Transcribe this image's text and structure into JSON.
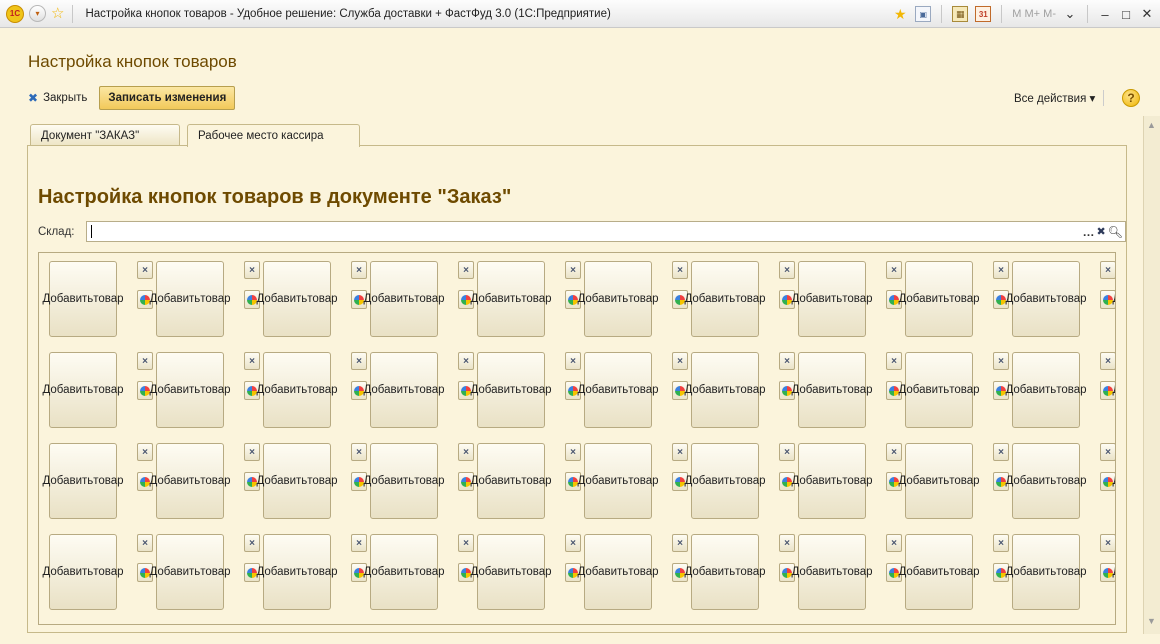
{
  "window": {
    "title": "Настройка кнопок товаров - Удобное решение: Служба доставки + ФастФуд 3.0  (1С:Предприятие)",
    "logo_text": "1С",
    "m_buttons": "M  M+ M-"
  },
  "form": {
    "title": "Настройка кнопок товаров",
    "close_label": "Закрыть",
    "save_label": "Записать изменения",
    "all_actions_label": "Все действия ▾",
    "help_label": "?"
  },
  "tabs": [
    {
      "label": "Документ \"ЗАКАЗ\"",
      "active": false
    },
    {
      "label": "Рабочее место кассира",
      "active": true
    }
  ],
  "section": {
    "title": "Настройка кнопок товаров в документе \"Заказ\"",
    "warehouse_label": "Склад:",
    "warehouse_value": ""
  },
  "grid": {
    "rows": 4,
    "columns": 11,
    "button_line1": "Добавить",
    "button_line2": "товар",
    "delete_icon": "×"
  },
  "colors": {
    "background": "#fbf4dc",
    "accent": "#6e4a00",
    "save_button": "#f2c95a"
  }
}
